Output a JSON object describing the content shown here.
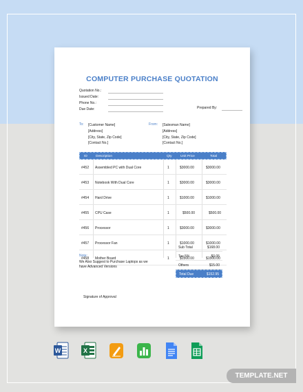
{
  "document": {
    "title": "COMPUTER PURCHASE QUOTATION",
    "meta": {
      "quotation_no": "Quotation No.:",
      "issued_date": "Issued Date:",
      "phone_no": "Phone No.:",
      "due_date": "Due Date:",
      "prepared_by": "Prepared By:"
    },
    "to": {
      "label": "To:",
      "lines": [
        "[Customer Name]",
        "[Address]",
        "[City, State, Zip Code]",
        "[Contact No.]"
      ]
    },
    "from": {
      "label": "From:",
      "lines": [
        "[Salesman Name]",
        "[Address]",
        "[City, State, Zip Code]",
        "[Contact No.]"
      ]
    },
    "table": {
      "headers": {
        "id": "ID",
        "description": "Description",
        "qty": "Qty",
        "unit_price": "Unit Price",
        "total": "Total"
      },
      "rows": [
        {
          "id": "#452",
          "description": "Assembled PC with Dual Core",
          "qty": "1",
          "unit_price": "$3000.00",
          "total": "$3000.00"
        },
        {
          "id": "#453",
          "description": "Notebook With Dual Core",
          "qty": "1",
          "unit_price": "$3000.00",
          "total": "$3000.00"
        },
        {
          "id": "#454",
          "description": "Hard Drive",
          "qty": "1",
          "unit_price": "$1000.00",
          "total": "$1000.00"
        },
        {
          "id": "#455",
          "description": "CPU Case",
          "qty": "1",
          "unit_price": "$500.00",
          "total": "$500.00"
        },
        {
          "id": "#456",
          "description": "Processor",
          "qty": "1",
          "unit_price": "$3000.00",
          "total": "$3000.00"
        },
        {
          "id": "#457",
          "description": "Processor Fan",
          "qty": "1",
          "unit_price": "$1000.00",
          "total": "$1000.00"
        },
        {
          "id": "#458",
          "description": "Mother Board",
          "qty": "1",
          "unit_price": "$1500.00",
          "total": "$1500.00"
        }
      ]
    },
    "totals": {
      "sub_total_label": "Sub Total",
      "sub_total": "$168.00",
      "tax_label": "Tax 5%",
      "tax": "$0.05",
      "others_label": "Others",
      "others": "$15.00",
      "total_due_label": "Total Due",
      "total_due": "$152.95"
    },
    "note": {
      "label": "Note:",
      "text": "We Also Suggest to Purchase Laptops as we have Advanced Versions"
    },
    "signature": "Signature of Approval"
  },
  "apps": [
    {
      "name": "word-icon",
      "letter": "W",
      "color": "#2b579a"
    },
    {
      "name": "excel-icon",
      "letter": "X",
      "color": "#217346"
    },
    {
      "name": "pages-icon",
      "letter": "",
      "color": "#f39c12"
    },
    {
      "name": "numbers-icon",
      "letter": "",
      "color": "#3bb54a"
    },
    {
      "name": "google-docs-icon",
      "letter": "",
      "color": "#4285f4"
    },
    {
      "name": "google-sheets-icon",
      "letter": "",
      "color": "#0f9d58"
    }
  ],
  "brand": "TEMPLATE.NET"
}
